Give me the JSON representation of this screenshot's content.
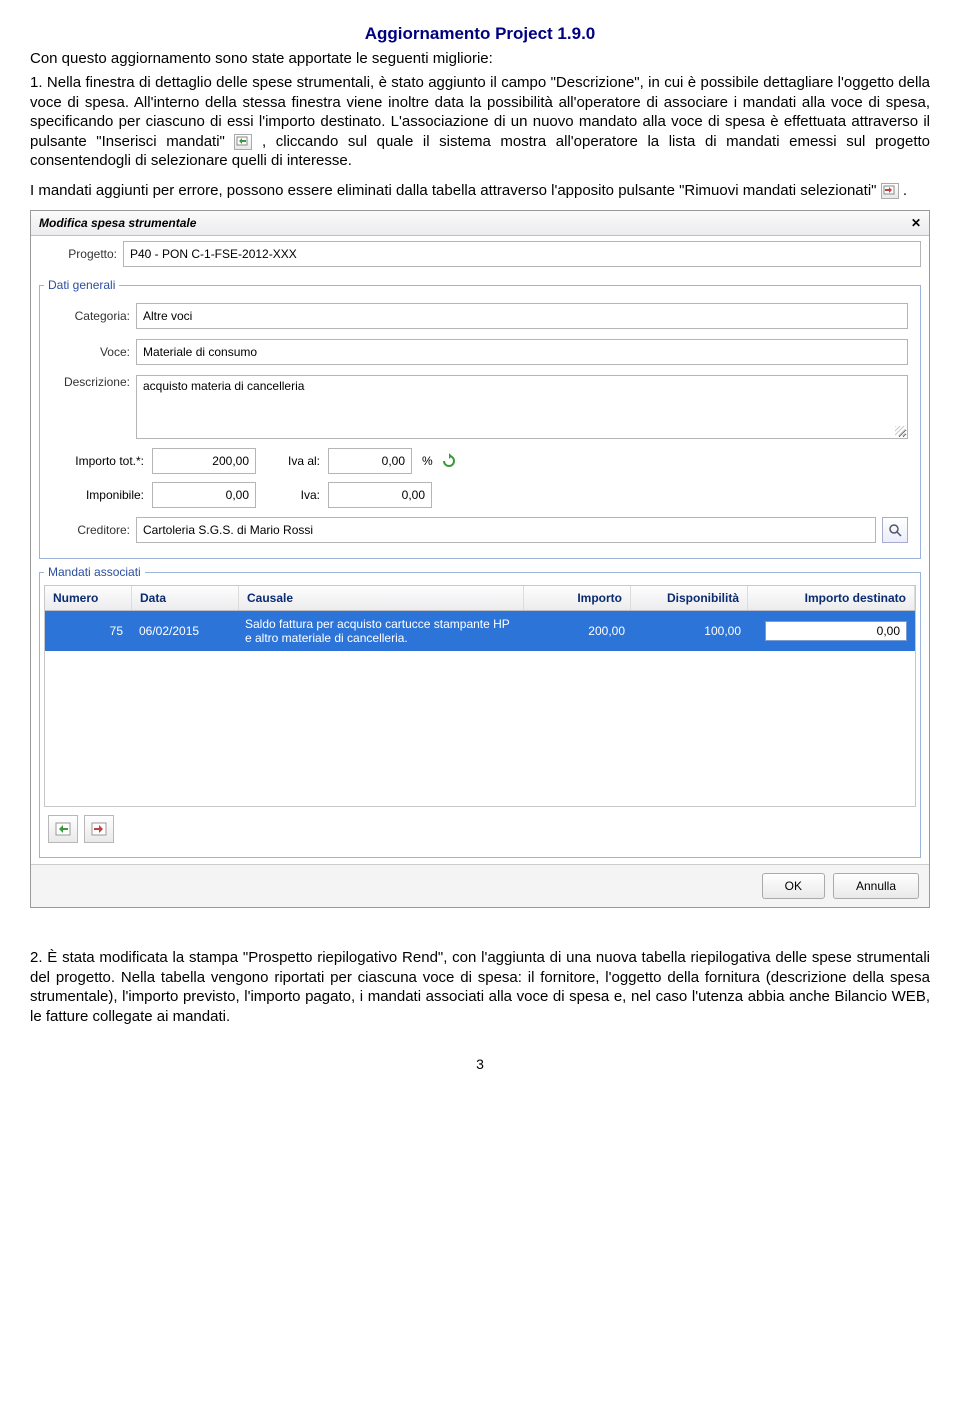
{
  "title": "Aggiornamento Project 1.9.0",
  "intro": "Con questo aggiornamento sono state apportate le seguenti migliorie:",
  "para1a": "1. Nella finestra di dettaglio delle spese strumentali, è stato  aggiunto il campo \"Descrizione\", in cui è possibile dettagliare l'oggetto della voce di spesa. All'interno della stessa finestra viene inoltre data la possibilità  all'operatore di associare i mandati alla voce di spesa, specificando per ciascuno di essi l'importo destinato. L'associazione di un nuovo mandato alla voce di spesa è effettuata  attraverso il pulsante \"Inserisci mandati\" ",
  "para1b": ", cliccando sul quale il sistema mostra all'operatore la lista di mandati emessi sul progetto  consentendogli di selezionare quelli di interesse.",
  "para2a": "I mandati aggiunti per errore, possono essere eliminati dalla tabella attraverso l'apposito pulsante \"Rimuovi mandati  selezionati\"",
  "para2b": ".",
  "dialog": {
    "title": "Modifica spesa strumentale",
    "progetto_lbl": "Progetto:",
    "progetto_val": "P40 - PON C-1-FSE-2012-XXX",
    "fs1_legend": "Dati generali",
    "categoria_lbl": "Categoria:",
    "categoria_val": "Altre voci",
    "voce_lbl": "Voce:",
    "voce_val": "Materiale di consumo",
    "descr_lbl": "Descrizione:",
    "descr_val": "acquisto materia di cancelleria",
    "importo_lbl": "Importo tot.*:",
    "importo_val": "200,00",
    "ivaal_lbl": "Iva al:",
    "ivaal_val": "0,00",
    "pct": "%",
    "imponibile_lbl": "Imponibile:",
    "imponibile_val": "0,00",
    "iva_lbl": "Iva:",
    "iva_val": "0,00",
    "creditore_lbl": "Creditore:",
    "creditore_val": "Cartoleria S.G.S. di Mario Rossi",
    "fs2_legend": "Mandati associati",
    "cols": {
      "numero": "Numero",
      "data": "Data",
      "causale": "Causale",
      "importo": "Importo",
      "disp": "Disponibilità",
      "dest": "Importo destinato"
    },
    "row": {
      "numero": "75",
      "data": "06/02/2015",
      "causale": "Saldo fattura per acquisto cartucce stampante HP e altro materiale di cancelleria.",
      "importo": "200,00",
      "disp": "100,00",
      "dest": "0,00"
    },
    "ok": "OK",
    "annulla": "Annulla"
  },
  "para3": "2. È stata modificata la stampa \"Prospetto riepilogativo Rend\", con l'aggiunta di una nuova tabella riepilogativa delle spese strumentali del progetto. Nella tabella vengono riportati per ciascuna voce di spesa: il fornitore, l'oggetto della fornitura (descrizione della spesa strumentale), l'importo previsto, l'importo pagato, i mandati associati alla voce di spesa e, nel caso l'utenza abbia anche Bilancio WEB, le fatture collegate ai mandati.",
  "page_number": "3"
}
